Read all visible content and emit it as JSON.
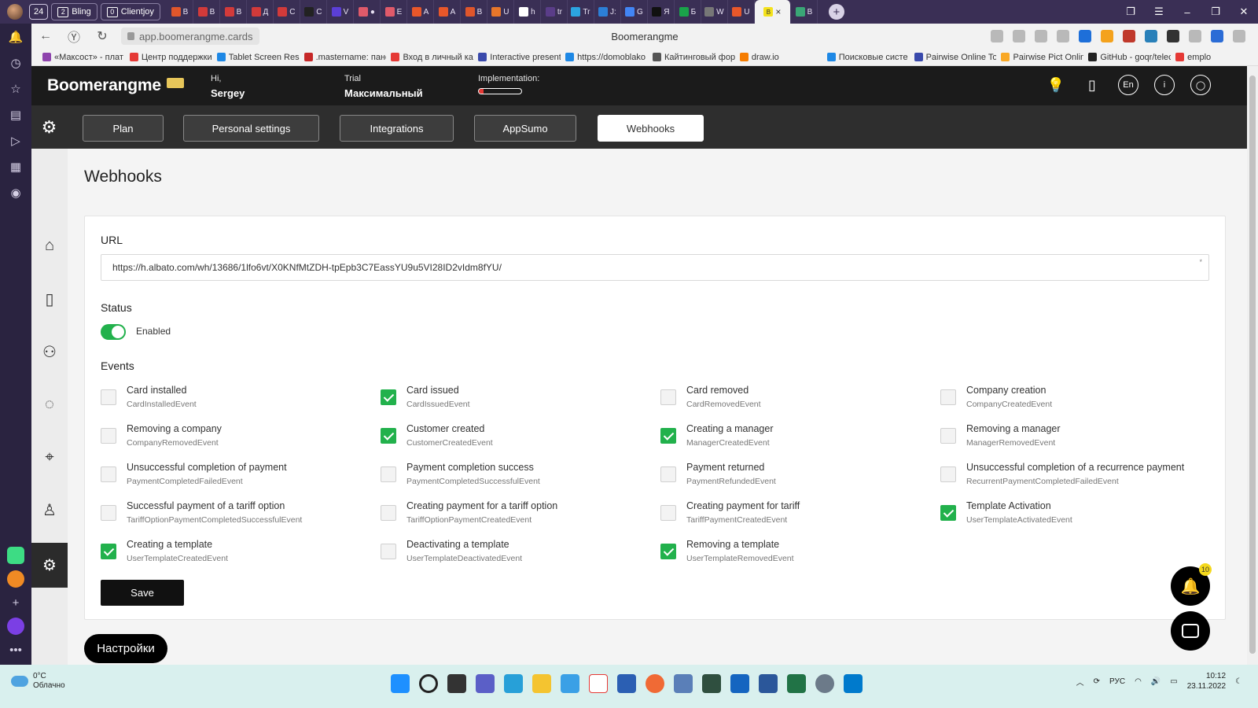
{
  "browser": {
    "tab_group_num": "24",
    "tab_pills": [
      {
        "num": "2",
        "label": "Bling"
      },
      {
        "num": "0",
        "label": "Clientjoy"
      }
    ],
    "tabs": [
      {
        "letter": "B",
        "color": "#e0562b"
      },
      {
        "letter": "B",
        "color": "#d23a3a"
      },
      {
        "letter": "B",
        "color": "#d23a3a"
      },
      {
        "letter": "Д",
        "color": "#d23a3a"
      },
      {
        "letter": "C",
        "color": "#d23a3a"
      },
      {
        "letter": "C",
        "color": "#222222"
      },
      {
        "letter": "V",
        "color": "#5b3fd6"
      },
      {
        "letter": "●",
        "color": "#e05a6a"
      },
      {
        "letter": "E",
        "color": "#e05a6a"
      },
      {
        "letter": "A",
        "color": "#e8572a"
      },
      {
        "letter": "A",
        "color": "#e8572a"
      },
      {
        "letter": "B",
        "color": "#e0562b"
      },
      {
        "letter": "U",
        "color": "#e8762a"
      },
      {
        "letter": "h",
        "color": "#ffffff"
      },
      {
        "letter": "tr",
        "color": "#5a3d88"
      },
      {
        "letter": "Tr",
        "color": "#2ca5e0"
      },
      {
        "letter": "J:",
        "color": "#2c7fd6"
      },
      {
        "letter": "G",
        "color": "#4285f4"
      },
      {
        "letter": "Я",
        "color": "#111111"
      },
      {
        "letter": "Б",
        "color": "#1aa34a"
      },
      {
        "letter": "W",
        "color": "#777777"
      },
      {
        "letter": "U",
        "color": "#e8572a"
      }
    ],
    "active_tab_letter": "B",
    "active_tab_close": "×",
    "last_tab_letter": "B",
    "new_tab": "+",
    "address": "app.boomerangme.cards",
    "page_title": "Boomerangme",
    "bookmarks": [
      {
        "label": "«Максост» - плат",
        "color": "#8e44ad"
      },
      {
        "label": "Центр поддержки",
        "color": "#e53935"
      },
      {
        "label": "Tablet Screen Resc",
        "color": "#1e88e5"
      },
      {
        "label": ".mastername: пане",
        "color": "#c62828"
      },
      {
        "label": "Вход в личный ка",
        "color": "#e53935"
      },
      {
        "label": "Interactive present",
        "color": "#3949ab"
      },
      {
        "label": "https://domoblako",
        "color": "#1e88e5"
      },
      {
        "label": "Кайтинговый фор",
        "color": "#555555"
      },
      {
        "label": "draw.io",
        "color": "#f57c00"
      },
      {
        "label": "Поисковые систе",
        "color": "#1e88e5"
      },
      {
        "label": "Pairwise Online To",
        "color": "#3949ab"
      },
      {
        "label": "Pairwise Pict Onlin",
        "color": "#f9a825"
      },
      {
        "label": "GitHub - goqr/telec",
        "color": "#222222"
      },
      {
        "label": "emplo",
        "color": "#e53935"
      }
    ]
  },
  "header": {
    "logo": "Boomerangme",
    "greeting": "Hi,",
    "user_name": "Sergey",
    "plan_label": "Trial",
    "plan_value": "Максимальный",
    "implementation_label": "Implementation:",
    "implementation_progress": 0.12,
    "lang": "En",
    "info": "i"
  },
  "settings_tabs": [
    "Plan",
    "Personal settings",
    "Integrations",
    "AppSumo",
    "Webhooks"
  ],
  "active_tab": "Webhooks",
  "page": {
    "title": "Webhooks",
    "url_label": "URL",
    "url_value": "https://h.albato.com/wh/13686/1lfo6vt/X0KNfMtZDH-tpEpb3C7EassYU9u5VI28ID2vIdm8fYU/",
    "required_mark": "*",
    "status_label": "Status",
    "status_enabled": true,
    "status_text": "Enabled",
    "events_label": "Events",
    "events": [
      {
        "title": "Card installed",
        "code": "CardInstalledEvent",
        "checked": false
      },
      {
        "title": "Card issued",
        "code": "CardIssuedEvent",
        "checked": true
      },
      {
        "title": "Card removed",
        "code": "CardRemovedEvent",
        "checked": false
      },
      {
        "title": "Company creation",
        "code": "CompanyCreatedEvent",
        "checked": false
      },
      {
        "title": "Removing a company",
        "code": "CompanyRemovedEvent",
        "checked": false
      },
      {
        "title": "Customer created",
        "code": "CustomerCreatedEvent",
        "checked": true
      },
      {
        "title": "Creating a manager",
        "code": "ManagerCreatedEvent",
        "checked": true
      },
      {
        "title": "Removing a manager",
        "code": "ManagerRemovedEvent",
        "checked": false
      },
      {
        "title": "Unsuccessful completion of payment",
        "code": "PaymentCompletedFailedEvent",
        "checked": false
      },
      {
        "title": "Payment completion success",
        "code": "PaymentCompletedSuccessfulEvent",
        "checked": false
      },
      {
        "title": "Payment returned",
        "code": "PaymentRefundedEvent",
        "checked": false
      },
      {
        "title": "Unsuccessful completion of a recurrence payment",
        "code": "RecurrentPaymentCompletedFailedEvent",
        "checked": false
      },
      {
        "title": "Successful payment of a tariff option",
        "code": "TariffOptionPaymentCompletedSuccessfulEvent",
        "checked": false
      },
      {
        "title": "Creating payment for a tariff option",
        "code": "TariffOptionPaymentCreatedEvent",
        "checked": false
      },
      {
        "title": "Creating payment for tariff",
        "code": "TariffPaymentCreatedEvent",
        "checked": false
      },
      {
        "title": "Template Activation",
        "code": "UserTemplateActivatedEvent",
        "checked": true
      },
      {
        "title": "Creating a template",
        "code": "UserTemplateCreatedEvent",
        "checked": true
      },
      {
        "title": "Deactivating a template",
        "code": "UserTemplateDeactivatedEvent",
        "checked": false
      },
      {
        "title": "Removing a template",
        "code": "UserTemplateRemovedEvent",
        "checked": true
      }
    ],
    "save_label": "Save",
    "settings_pill": "Настройки",
    "notifications_count": "10"
  },
  "taskbar": {
    "temperature": "0°C",
    "weather": "Облачно",
    "lang": "РУС",
    "time": "10:12",
    "date": "23.11.2022"
  },
  "colors": {
    "accent_green": "#22b14c",
    "header_bg": "#1b1b1b",
    "progress_red": "#e53935"
  }
}
